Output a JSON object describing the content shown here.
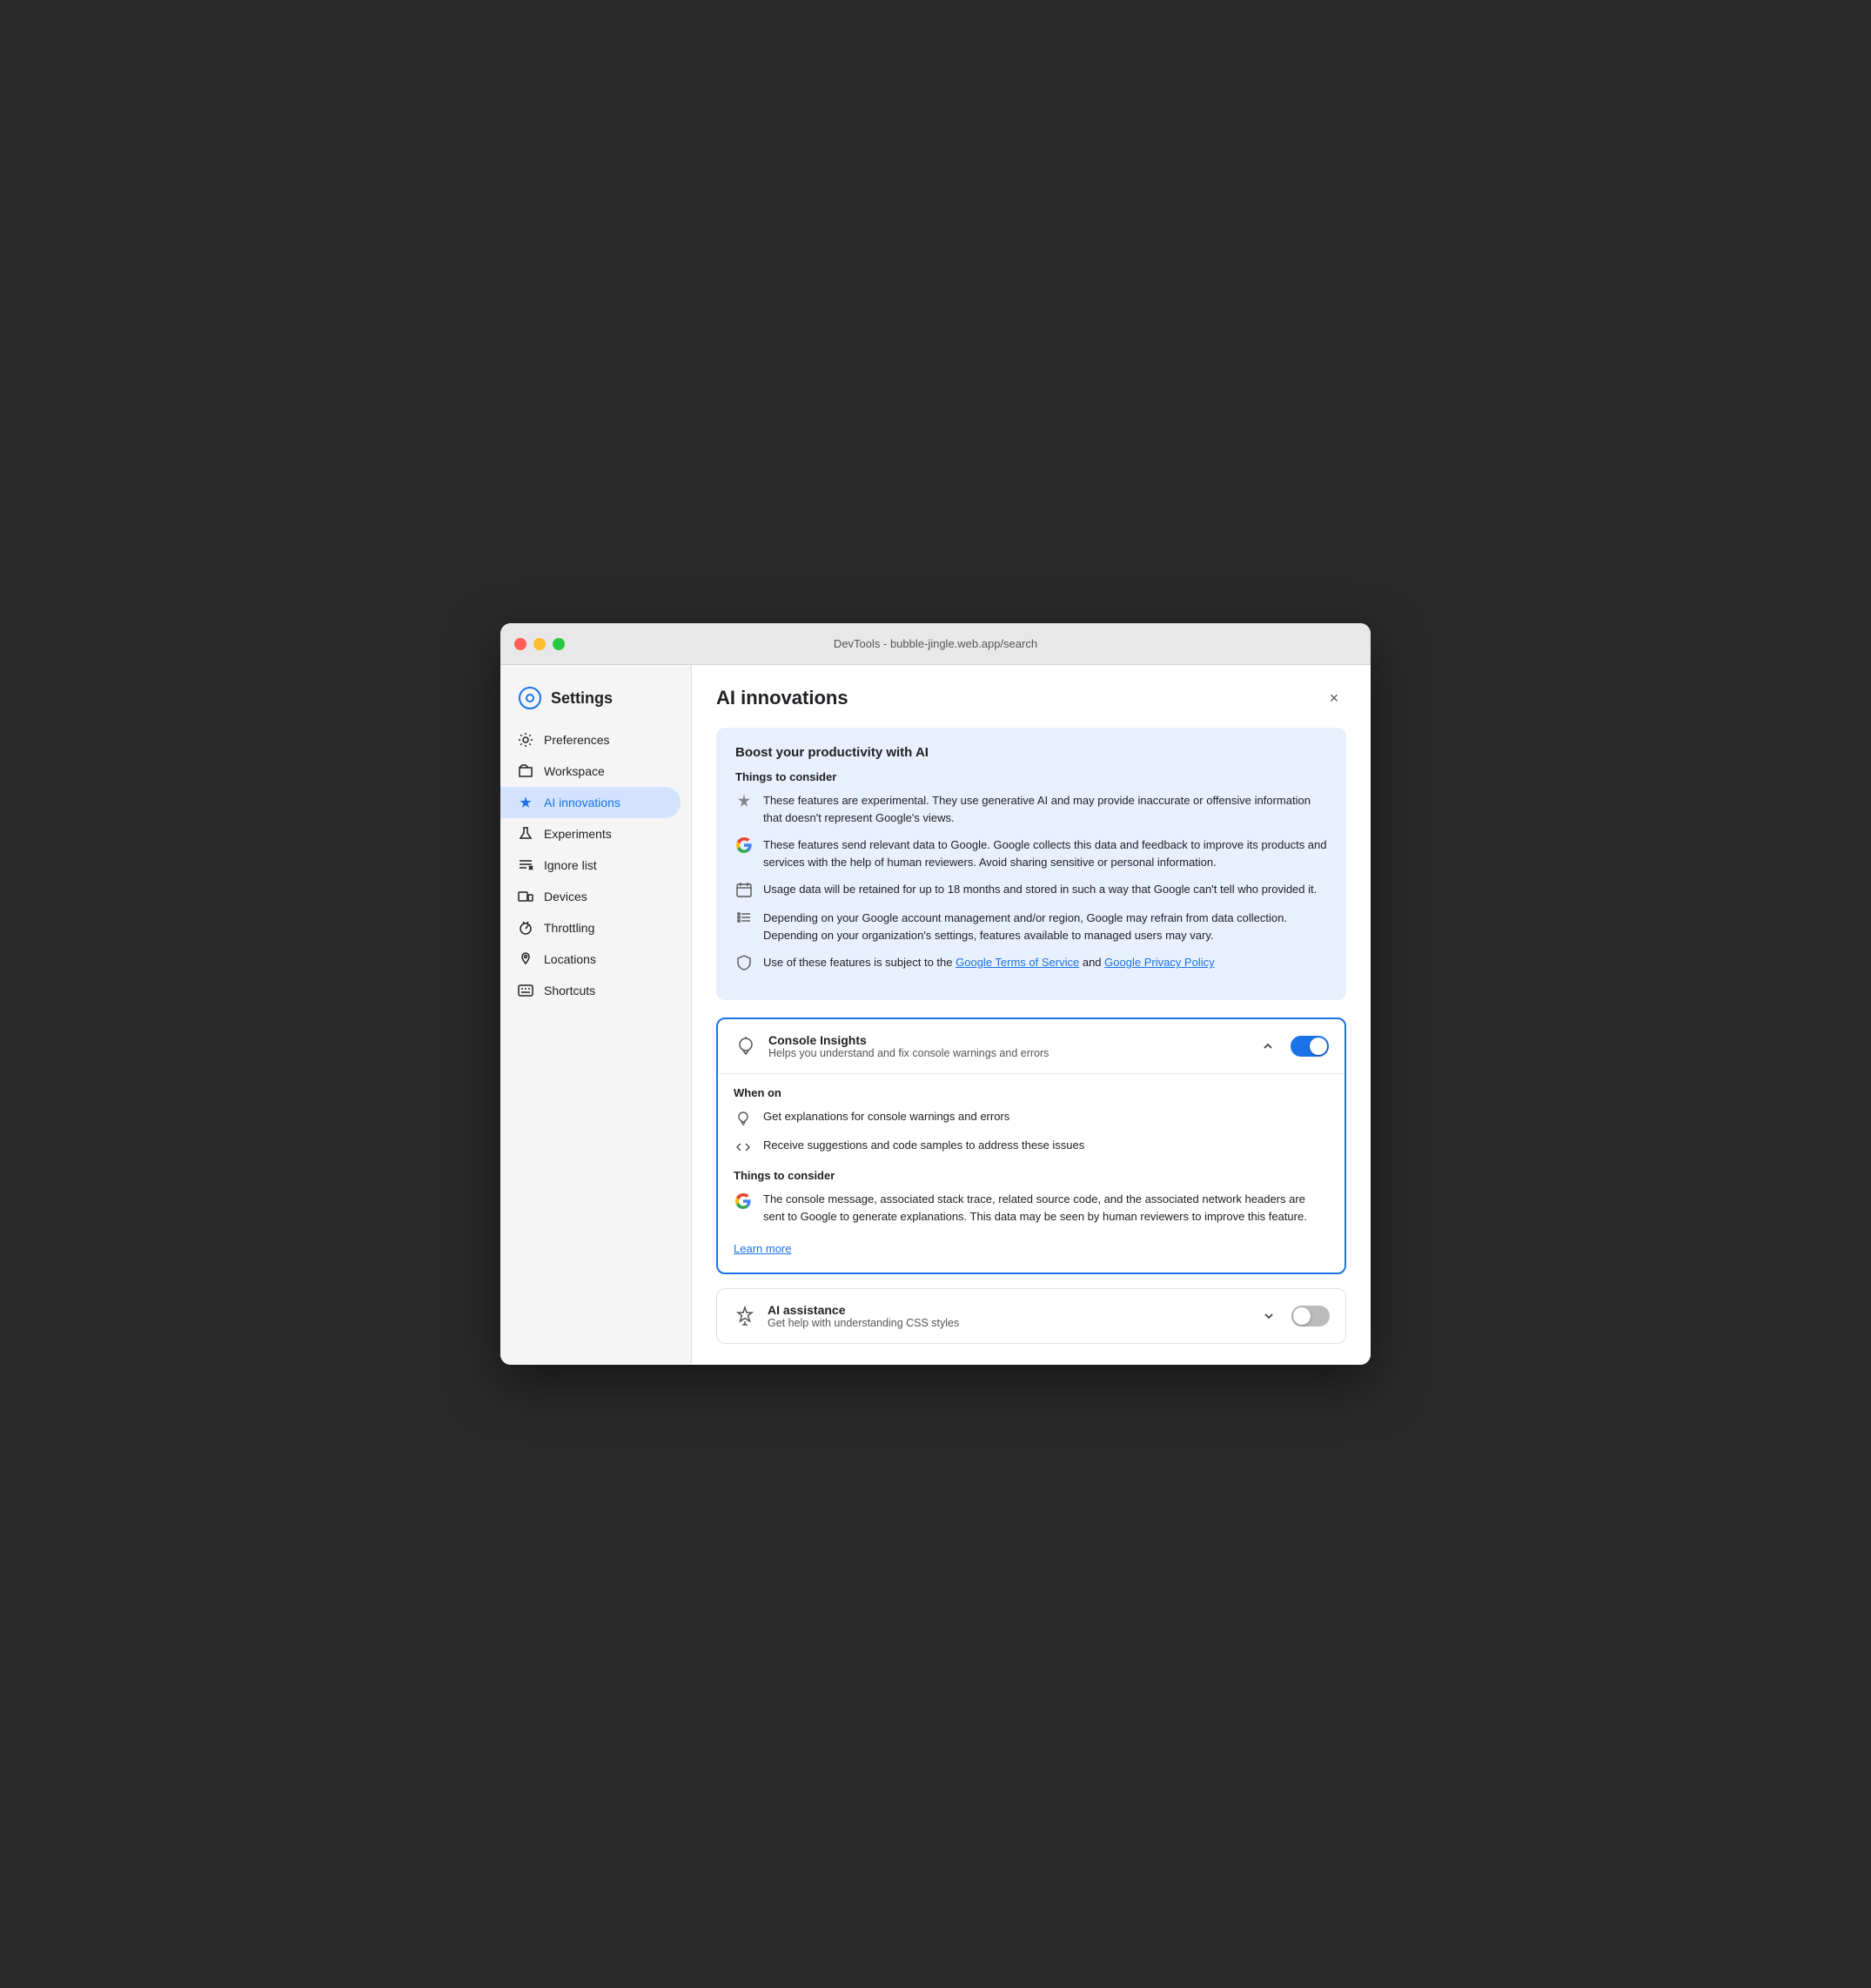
{
  "window": {
    "title": "DevTools - bubble-jingle.web.app/search",
    "close_label": "×"
  },
  "sidebar": {
    "title": "Settings",
    "items": [
      {
        "id": "preferences",
        "label": "Preferences",
        "icon": "gear"
      },
      {
        "id": "workspace",
        "label": "Workspace",
        "icon": "folder"
      },
      {
        "id": "ai-innovations",
        "label": "AI innovations",
        "icon": "sparkle",
        "active": true
      },
      {
        "id": "experiments",
        "label": "Experiments",
        "icon": "flask"
      },
      {
        "id": "ignore-list",
        "label": "Ignore list",
        "icon": "ignore"
      },
      {
        "id": "devices",
        "label": "Devices",
        "icon": "devices"
      },
      {
        "id": "throttling",
        "label": "Throttling",
        "icon": "throttle"
      },
      {
        "id": "locations",
        "label": "Locations",
        "icon": "location"
      },
      {
        "id": "shortcuts",
        "label": "Shortcuts",
        "icon": "keyboard"
      }
    ]
  },
  "main": {
    "title": "AI innovations",
    "info_card": {
      "heading": "Boost your productivity with AI",
      "things_title": "Things to consider",
      "items": [
        {
          "text": "These features are experimental. They use generative AI and may provide inaccurate or offensive information that doesn't represent Google's views.",
          "icon": "sparkle-sm"
        },
        {
          "text": "These features send relevant data to Google. Google collects this data and feedback to improve its products and services with the help of human reviewers. Avoid sharing sensitive or personal information.",
          "icon": "google"
        },
        {
          "text": "Usage data will be retained for up to 18 months and stored in such a way that Google can't tell who provided it.",
          "icon": "calendar"
        },
        {
          "text": "Depending on your Google account management and/or region, Google may refrain from data collection. Depending on your organization's settings, features available to managed users may vary.",
          "icon": "list"
        },
        {
          "text_before": "Use of these features is subject to the ",
          "link1_text": "Google Terms of Service",
          "link1_href": "#",
          "text_middle": " and ",
          "link2_text": "Google Privacy Policy",
          "link2_href": "#",
          "icon": "shield"
        }
      ]
    },
    "console_insights": {
      "name": "Console Insights",
      "desc": "Helps you understand and fix console warnings and errors",
      "enabled": true,
      "expanded": true,
      "when_on_title": "When on",
      "when_on_items": [
        {
          "text": "Get explanations for console warnings and errors",
          "icon": "lightbulb"
        },
        {
          "text": "Receive suggestions and code samples to address these issues",
          "icon": "code"
        }
      ],
      "things_title": "Things to consider",
      "things_items": [
        {
          "text": "The console message, associated stack trace, related source code, and the associated network headers are sent to Google to generate explanations. This data may be seen by human reviewers to improve this feature.",
          "icon": "google"
        }
      ],
      "learn_more": "Learn more"
    },
    "ai_assistance": {
      "name": "AI assistance",
      "desc": "Get help with understanding CSS styles",
      "enabled": false,
      "expanded": false
    }
  }
}
